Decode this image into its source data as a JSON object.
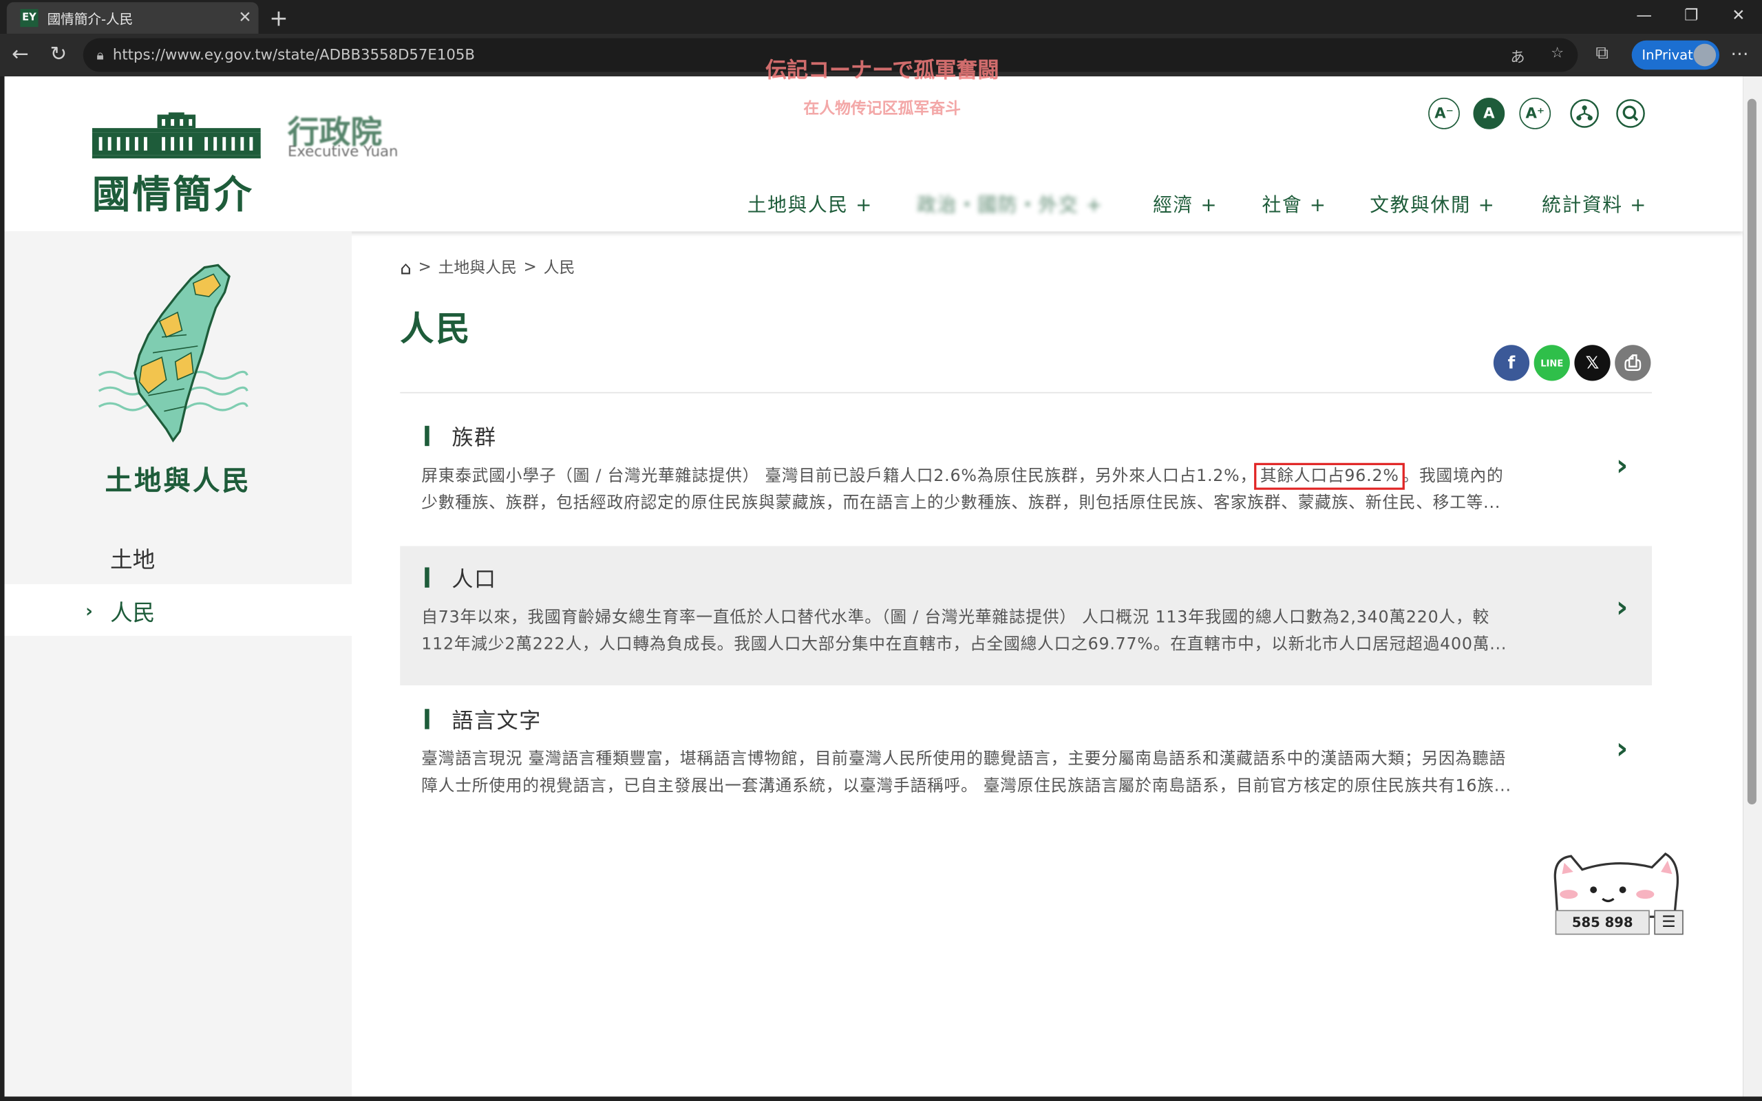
{
  "browser": {
    "tab_title": "國情簡介-人民",
    "favicon_text": "EY",
    "url": "https://www.ey.gov.tw/state/ADBB3558D57E105B",
    "inprivate_label": "InPrivate"
  },
  "overlay": {
    "jp": "伝記コーナーで孤軍奮闘",
    "cn": "在人物传记区孤军奋斗"
  },
  "header": {
    "logo_title": "國情簡介",
    "logo_ey_cn": "行政院",
    "logo_ey_en": "Executive Yuan",
    "tools": [
      "A⁻",
      "A",
      "A⁺"
    ],
    "nav": [
      "土地與人民 +",
      "政治・國防・外交 +",
      "經濟 +",
      "社會 +",
      "文教與休閒 +",
      "統計資料 +"
    ]
  },
  "sidebar": {
    "title": "土地與人民",
    "items": [
      {
        "label": "土地"
      },
      {
        "label": "人民"
      }
    ]
  },
  "breadcrumb": {
    "sep": ">",
    "items": [
      "土地與人民",
      "人民"
    ]
  },
  "page_title": "人民",
  "share": {
    "fb": "f",
    "line": "LINE",
    "x": "𝕏",
    "print": "⎙"
  },
  "cards": [
    {
      "title": "族群",
      "line1_pre": "屏東泰武國小學子（圖 / 台灣光華雜誌提供） 臺灣目前已設戶籍人口2.6%為原住民族群，另外來人口占1.2%，",
      "line1_highlight": "其餘人口占96.2%",
      "line1_post": "。我國境內的",
      "line2": "少數種族、族群，包括經政府認定的原住民族與蒙藏族，而在語言上的少數種族、族群，則包括原住民族、客家族群、蒙藏族、新住民、移工等..."
    },
    {
      "title": "人口",
      "line1": "自73年以來，我國育齡婦女總生育率一直低於人口替代水準。（圖 / 台灣光華雜誌提供） 人口概況 113年我國的總人口數為2,340萬220人，較",
      "line2": "112年減少2萬222人，人口轉為負成長。我國人口大部分集中在直轄市，占全國總人口之69.77%。在直轄市中，以新北市人口居冠超過400萬..."
    },
    {
      "title": "語言文字",
      "line1": "臺灣語言現況 臺灣語言種類豐富，堪稱語言博物館，目前臺灣人民所使用的聽覺語言，主要分屬南島語系和漢藏語系中的漢語兩大類；另因為聽語",
      "line2": "障人士所使用的視覺語言，已自主發展出一套溝通系統，以臺灣手語稱呼。 臺灣原住民族語言屬於南島語系，目前官方核定的原住民族共有16族..."
    }
  ],
  "widget": {
    "counter": "585 898",
    "menu_icon": "☰"
  },
  "colors": {
    "brand_green": "#1e5c3a",
    "map_yellow": "#f2c44e",
    "map_teal": "#7fcdb1",
    "highlight_red": "#e12626"
  }
}
